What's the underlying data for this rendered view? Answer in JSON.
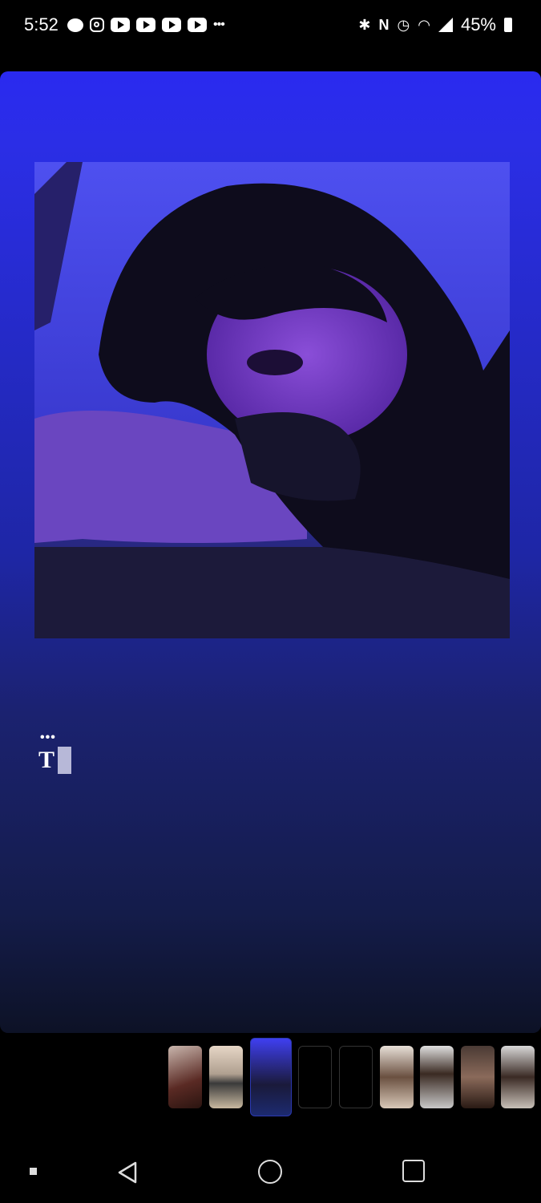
{
  "status_bar": {
    "time": "5:52",
    "battery": "45%",
    "notification_icons": [
      "chat-icon",
      "instagram-icon",
      "youtube-icon",
      "youtube-icon",
      "youtube-icon",
      "youtube-icon",
      "more-icon"
    ],
    "system_icons": [
      "bluetooth-icon",
      "nfc-icon",
      "alarm-icon",
      "wifi-icon",
      "signal-icon",
      "battery-icon"
    ]
  },
  "story": {
    "background_top": "#2a2af0",
    "background_bottom": "#0d1226",
    "options_text": "•••",
    "text_tool_glyph": "T"
  },
  "thumbnails": {
    "count": 9,
    "active_index": 2
  },
  "nav": [
    "back-icon",
    "home-icon",
    "recents-icon"
  ]
}
